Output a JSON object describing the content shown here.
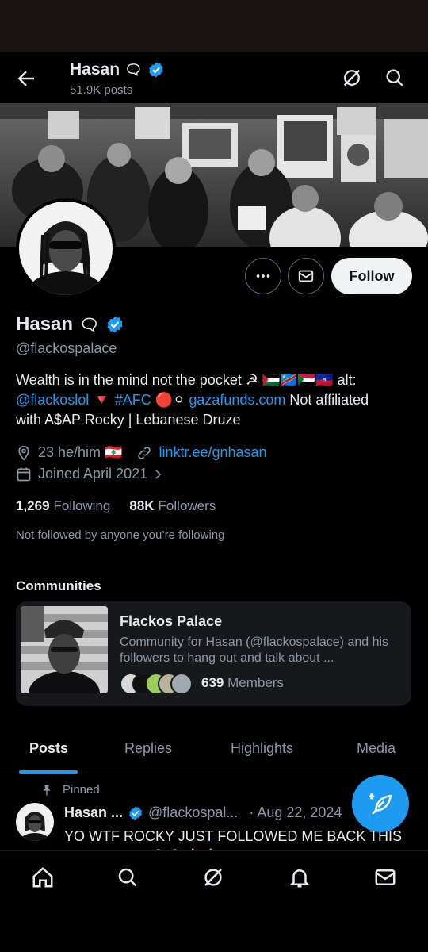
{
  "header": {
    "name": "Hasan",
    "name_emoji": "🗨",
    "post_count": "51.9K posts"
  },
  "actions": {
    "more_label": "•••",
    "follow_label": "Follow"
  },
  "profile": {
    "name": "Hasan",
    "name_emoji": "🗨",
    "handle": "@flackospalace",
    "bio": {
      "line1_text": "Wealth is in the mind not the pocket ☭ 🇵🇸🇨🇩🇸🇩🇭🇹 alt:",
      "alt_handle": "@flackoslol",
      "triangle": "🔻",
      "hashtag": "#AFC",
      "circles": "🔴⚪",
      "link": "gazafunds.com",
      "tail1": "Not affiliated",
      "line3": "with A$AP Rocky | Lebanese Druze"
    },
    "location": "23 he/him 🇱🇧",
    "website": "linktr.ee/gnhasan",
    "joined": "Joined April 2021",
    "following_count": "1,269",
    "following_label": "Following",
    "followers_count": "88K",
    "followers_label": "Followers",
    "not_followed": "Not followed by anyone you’re following"
  },
  "communities": {
    "title": "Communities",
    "card": {
      "name": "Flackos Palace",
      "description": "Community for Hasan (@flackospalace) and his followers to hang out and talk about ...",
      "members_count": "639",
      "members_label": "Members"
    }
  },
  "tabs": [
    "Posts",
    "Replies",
    "Highlights",
    "Media"
  ],
  "pinned_tweet": {
    "pinned_label": "Pinned",
    "name": "Hasan ...",
    "handle": "@flackospal...",
    "date": "· Aug 22, 2024",
    "text": "YO WTF ROCKY JUST FOLLOWED ME BACK THIS IS CRAZY?? 😭😭👍👍"
  },
  "colors": {
    "accent": "#1d9bf0",
    "background": "#000000",
    "text": "#e7e9ea",
    "muted": "#8b98a5"
  },
  "icons": {
    "back": "arrow-left-icon",
    "grok": "grok-icon",
    "search": "search-icon",
    "more": "more-icon",
    "message": "envelope-icon",
    "verified": "verified-badge-icon",
    "location": "location-pin-icon",
    "link": "link-icon",
    "calendar": "calendar-icon",
    "pin": "pin-icon",
    "compose": "compose-icon",
    "nav": [
      "home-icon",
      "search-icon",
      "grok-icon",
      "bell-icon",
      "mail-icon"
    ]
  }
}
